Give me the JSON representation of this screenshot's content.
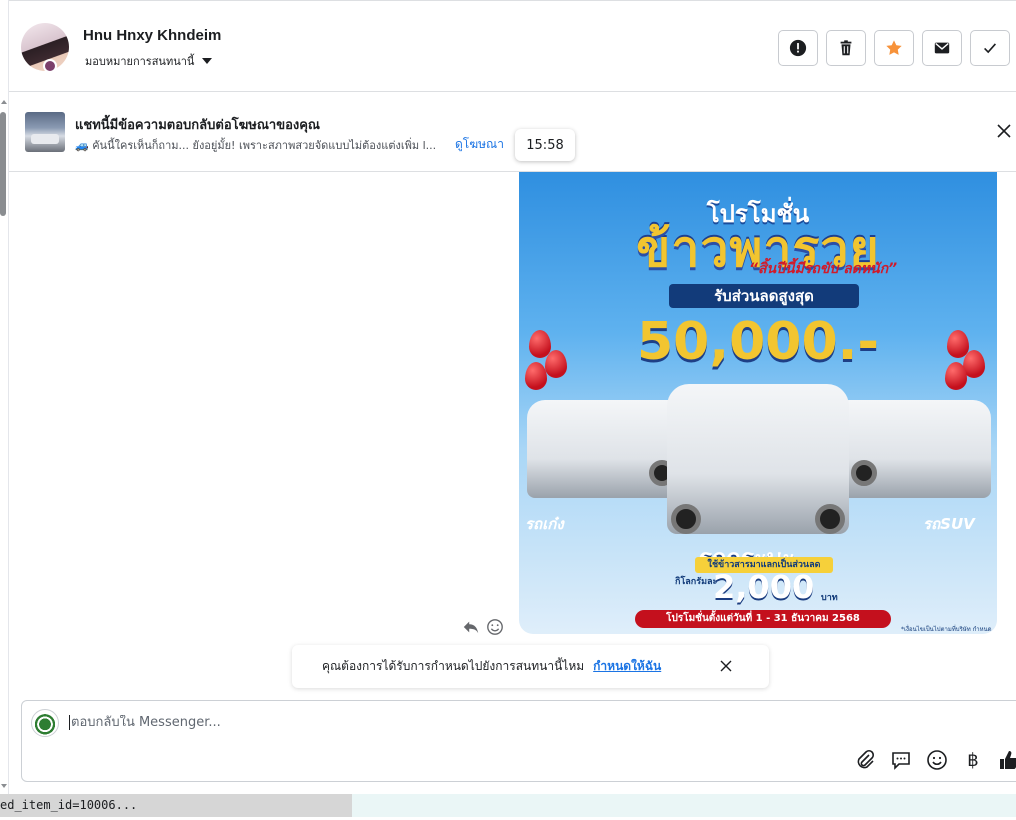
{
  "header": {
    "user_name": "Hnu Hnxy Khndeim",
    "assign_label": "มอบหมายการสนทนานี้",
    "actions": [
      "alert-icon",
      "trash-icon",
      "star-icon",
      "mail-icon",
      "check-icon"
    ],
    "star_color": "#f7923a"
  },
  "ad_banner": {
    "title": "แชทนี้มีข้อความตอบกลับต่อโฆษณาของคุณ",
    "snippet": "🚙 คันนี้ใครเห็นก็ถาม... ยังอยู่มั้ย! เพราะสภาพสวยจัดแบบไม่ต้องแต่งเพิ่ม l...",
    "link": "ดูโฆษณา",
    "tooltip_time": "15:58"
  },
  "message_image": {
    "heading": "โปรโมชั่น",
    "title": "ข้าวพารวย",
    "subtitle": "“สิ้นปีนี้มีรถขับ ลดหนัก”",
    "band": "รับส่วนลดสูงสุด",
    "amount": "50,000.-",
    "label_sedan": "รถเก๋ง",
    "label_suv": "รถSUV",
    "label_pickup": "รถกระบะ",
    "rice_tag": "ใช้ข้าวสารมาแลกเป็นส่วนลด",
    "per_kg": "กิโลกรัมละ",
    "price": "2,000",
    "baht": "บาท",
    "period": "โปรโมชั่นตั้งแต่วันที่ 1 - 31 ธันวาคม 2568",
    "conditions": "*เงื่อนไขเป็นไปตามที่บริษัท กำหนด"
  },
  "reminder": {
    "text": "คุณต้องการได้รับการกำหนดไปยังการสนทนานี้ไหม",
    "link": "กำหนดให้ฉัน"
  },
  "composer": {
    "placeholder": "ตอบกลับใน Messenger...",
    "tools": [
      "paperclip-icon",
      "chat-bubble-icon",
      "emoji-icon",
      "baht-icon",
      "thumbs-up-icon"
    ],
    "baht_symbol": "฿"
  },
  "status_bar": {
    "url": "ed_item_id=10006..."
  }
}
